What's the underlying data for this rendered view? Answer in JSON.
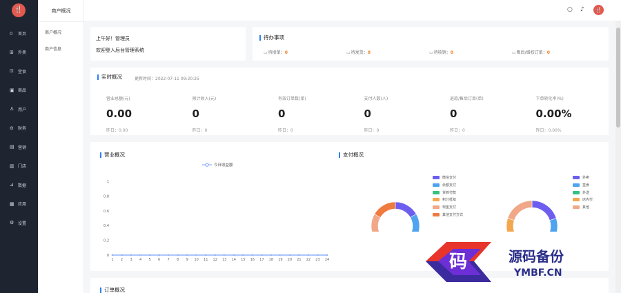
{
  "logo": {
    "glyph": "🍴"
  },
  "nav": {
    "items": [
      {
        "label": "首页",
        "icon": "home-icon",
        "glyph": "⌂"
      },
      {
        "label": "外卖",
        "icon": "takeout-icon",
        "glyph": "⊞"
      },
      {
        "label": "堂食",
        "icon": "dinein-icon",
        "glyph": "⊡"
      },
      {
        "label": "商品",
        "icon": "goods-icon",
        "glyph": "▣"
      },
      {
        "label": "用户",
        "icon": "user-icon",
        "glyph": "♙"
      },
      {
        "label": "财务",
        "icon": "finance-icon",
        "glyph": "⊖"
      },
      {
        "label": "营销",
        "icon": "marketing-icon",
        "glyph": "▤"
      },
      {
        "label": "门店",
        "icon": "store-icon",
        "glyph": "▥"
      },
      {
        "label": "数据",
        "icon": "data-icon",
        "glyph": "⊿"
      },
      {
        "label": "应用",
        "icon": "app-icon",
        "glyph": "▦"
      },
      {
        "label": "设置",
        "icon": "settings-icon",
        "glyph": "⚙"
      }
    ]
  },
  "subnav": {
    "title": "商户概况",
    "items": [
      {
        "label": "商户概况"
      },
      {
        "label": "商户信息"
      }
    ]
  },
  "topbar": {
    "search_glyph": "○",
    "bell_glyph": "♪",
    "avatar_glyph": "🍴"
  },
  "greeting": {
    "line1": "上午好！管理员",
    "line2": "欢迎登入后台管理系统"
  },
  "todo": {
    "title": "待办事项",
    "items": [
      {
        "label": "待接单：",
        "value": "0"
      },
      {
        "label": "待发货：",
        "value": "0"
      },
      {
        "label": "待核销：",
        "value": "0"
      },
      {
        "label": "售后/维权订单：",
        "value": "0"
      }
    ]
  },
  "realtime": {
    "title": "实时概况",
    "time": "更新时间：2022-07-11 09:30:25",
    "stats": [
      {
        "label": "营业总额(元)",
        "value": "0.00",
        "yesterday": "昨日：0.00"
      },
      {
        "label": "预计收入(元)",
        "value": "0",
        "yesterday": "昨日：0"
      },
      {
        "label": "有效订单数(单)",
        "value": "0",
        "yesterday": "昨日：0"
      },
      {
        "label": "支付人数(人)",
        "value": "0",
        "yesterday": "昨日：0"
      },
      {
        "label": "退款/售后订单(单)",
        "value": "0",
        "yesterday": "昨日：0"
      },
      {
        "label": "下单转化率(%)",
        "value": "0.00%",
        "yesterday": "昨日：0.00%"
      }
    ]
  },
  "business": {
    "title": "营业概况",
    "legend": "今日收益额"
  },
  "pay": {
    "title": "支付概况",
    "legend1": [
      "微信支付",
      "余额支付",
      "货到付款",
      "积分抵扣",
      "现金支付",
      "其他支付方式"
    ],
    "legend2": [
      "外卖",
      "堂食",
      "外送",
      "店内付",
      "其他"
    ]
  },
  "orders": {
    "title": "订单概况"
  },
  "chart_data": [
    {
      "type": "line",
      "title": "营业概况",
      "series": [
        {
          "name": "今日收益额",
          "values": [
            0,
            0,
            0,
            0,
            0,
            0,
            0,
            0,
            0,
            0,
            0,
            0,
            0,
            0,
            0,
            0,
            0,
            0,
            0,
            0,
            0,
            0,
            0,
            0
          ]
        }
      ],
      "x": [
        "1",
        "2",
        "3",
        "4",
        "5",
        "6",
        "7",
        "8",
        "9",
        "10",
        "11",
        "12",
        "13",
        "14",
        "15",
        "16",
        "17",
        "18",
        "19",
        "20",
        "21",
        "22",
        "23",
        "24"
      ],
      "y_ticks": [
        "0",
        "0.2",
        "0.4",
        "0.6",
        "0.8",
        "1"
      ],
      "ylim": [
        0,
        1
      ],
      "grid": false,
      "legend": "top-center",
      "color": "#5b8ff9"
    },
    {
      "type": "pie",
      "title": "支付概况",
      "labels": [
        "微信支付",
        "余额支付",
        "货到付款",
        "积分抵扣",
        "现金支付",
        "其他支付方式"
      ],
      "values": [
        1,
        1,
        1,
        1,
        1,
        1
      ],
      "colors": [
        "#6e5ef0",
        "#4fa3ef",
        "#36c184",
        "#f3a84f",
        "#f0a888",
        "#f07b3f"
      ],
      "legend": "right"
    },
    {
      "type": "pie",
      "labels": [
        "外卖",
        "堂食",
        "外送",
        "店内付",
        "其他"
      ],
      "values": [
        1,
        1,
        1,
        1,
        1
      ],
      "colors": [
        "#6e5ef0",
        "#4fa3ef",
        "#36c184",
        "#f3a84f",
        "#f0a888"
      ],
      "legend": "right"
    }
  ],
  "watermark": {
    "glyph": "码",
    "title": "源码备份",
    "url": "YMBF.CN"
  }
}
